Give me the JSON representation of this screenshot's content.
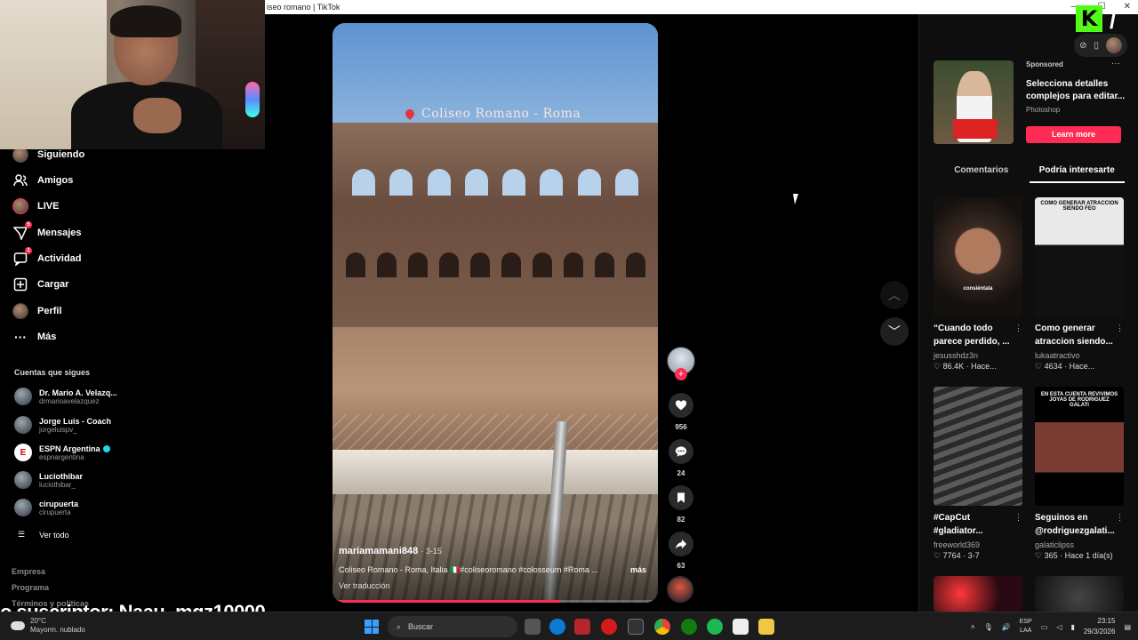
{
  "window": {
    "title": "Coliseo romano | TikTok",
    "title_visible": "iseo romano | TikTok"
  },
  "sidebar": {
    "nav": [
      {
        "label": "Siguiendo",
        "icon": "following-icon"
      },
      {
        "label": "Amigos",
        "icon": "friends-icon"
      },
      {
        "label": "LIVE",
        "icon": "live-icon"
      },
      {
        "label": "Mensajes",
        "icon": "messages-icon",
        "badge": "5"
      },
      {
        "label": "Actividad",
        "icon": "activity-icon",
        "badge": "1"
      },
      {
        "label": "Cargar",
        "icon": "upload-icon"
      },
      {
        "label": "Perfil",
        "icon": "profile-icon"
      },
      {
        "label": "Más",
        "icon": "more-icon"
      }
    ],
    "following_title": "Cuentas que sigues",
    "following": [
      {
        "name": "Dr. Mario A. Velazq...",
        "handle": "drmarioavelazquez"
      },
      {
        "name": "Jorge Luis - Coach",
        "handle": "jorgeluispv_"
      },
      {
        "name": "ESPN Argentina",
        "handle": "espnargentina",
        "verified": true
      },
      {
        "name": "Luciothibar",
        "handle": "luciothibar_"
      },
      {
        "name": "cirupuerta",
        "handle": "cirupuerta"
      }
    ],
    "see_all": "Ver todo",
    "footer": [
      "Empresa",
      "Programa",
      "Términos y políticas"
    ]
  },
  "video": {
    "location": "Coliseo Romano - Roma",
    "author": "mariamamani848",
    "date": "3-15",
    "description": "Coliseo Romano - Roma, Italia 🇮🇹#coliseoromano #colosseum #Roma ...",
    "more": "más",
    "translate": "Ver traducción",
    "progress": 0.7
  },
  "actions": {
    "likes": "956",
    "comments": "24",
    "saves": "82",
    "shares": "63",
    "follow_plus": "+"
  },
  "right_panel": {
    "ad": {
      "sponsored": "Sponsored",
      "title": "Selecciona detalles complejos para editar...",
      "brand": "Photoshop",
      "cta": "Learn more"
    },
    "tabs": [
      "Comentarios",
      "Podría interesarte"
    ],
    "active_tab": 1,
    "cards": [
      {
        "title": "“Cuando todo parece perdido, ...",
        "user": "jesusshdz3n",
        "stats": "86.4K · Hace...",
        "thumb_text": "consiéntala"
      },
      {
        "title": "Como generar atraccion siendo...",
        "user": "lukaatractivo",
        "stats": "4634 · Hace...",
        "thumb_text": "COMO GENERAR ATRACCION SIENDO FEO"
      },
      {
        "title": "#CapCut #gladiator...",
        "user": "freeworld369",
        "stats": "7764 · 3-7",
        "thumb_text": ""
      },
      {
        "title": "Seguinos en @rodriguezgalati...",
        "user": "galaticlipss",
        "stats": "365 · Hace 1 día(s)",
        "thumb_text": "EN ESTA CUENTA REVIVIMOS JOYAS DE RODRIGUEZ GALATI"
      }
    ]
  },
  "overlay_text": "o suscriptor: Naau_mqz10000",
  "taskbar": {
    "weather_temp": "20°C",
    "weather_desc": "Mayorm. nublado",
    "search_placeholder": "Buscar",
    "lang_1": "ESP",
    "lang_2": "LAA",
    "time": "23:15",
    "date": "29/3/2026"
  },
  "colors": {
    "accent": "#fe2c55",
    "kick": "#53fc18"
  }
}
